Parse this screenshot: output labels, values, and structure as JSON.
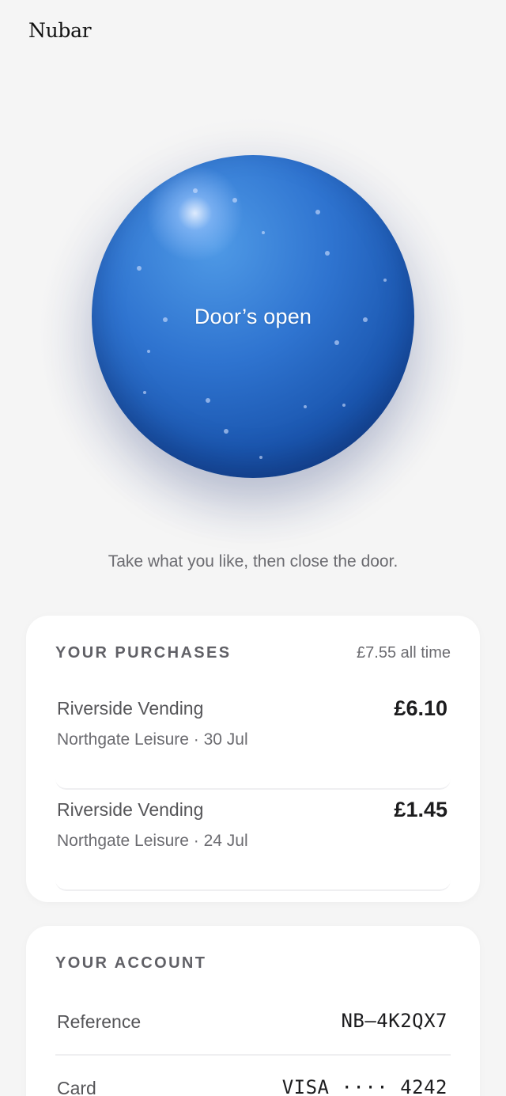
{
  "app": {
    "brand": "Nubar"
  },
  "door": {
    "label": "Door’s open",
    "hint": "Take what you like, then close the door.",
    "color": "#1f5fbf"
  },
  "purchases": {
    "title": "YOUR PURCHASES",
    "total": "£7.55 all time",
    "items": [
      {
        "merchant": "Riverside Vending",
        "meta": "Northgate Leisure · 30 Jul",
        "amount": "£6.10"
      },
      {
        "merchant": "Riverside Vending",
        "meta": "Northgate Leisure · 24 Jul",
        "amount": "£1.45"
      }
    ]
  },
  "account": {
    "title": "YOUR ACCOUNT",
    "rows": [
      {
        "label": "Reference",
        "value": "NB–4K2QX7"
      },
      {
        "label": "Card",
        "value": "VISA ···· 4242"
      }
    ]
  }
}
